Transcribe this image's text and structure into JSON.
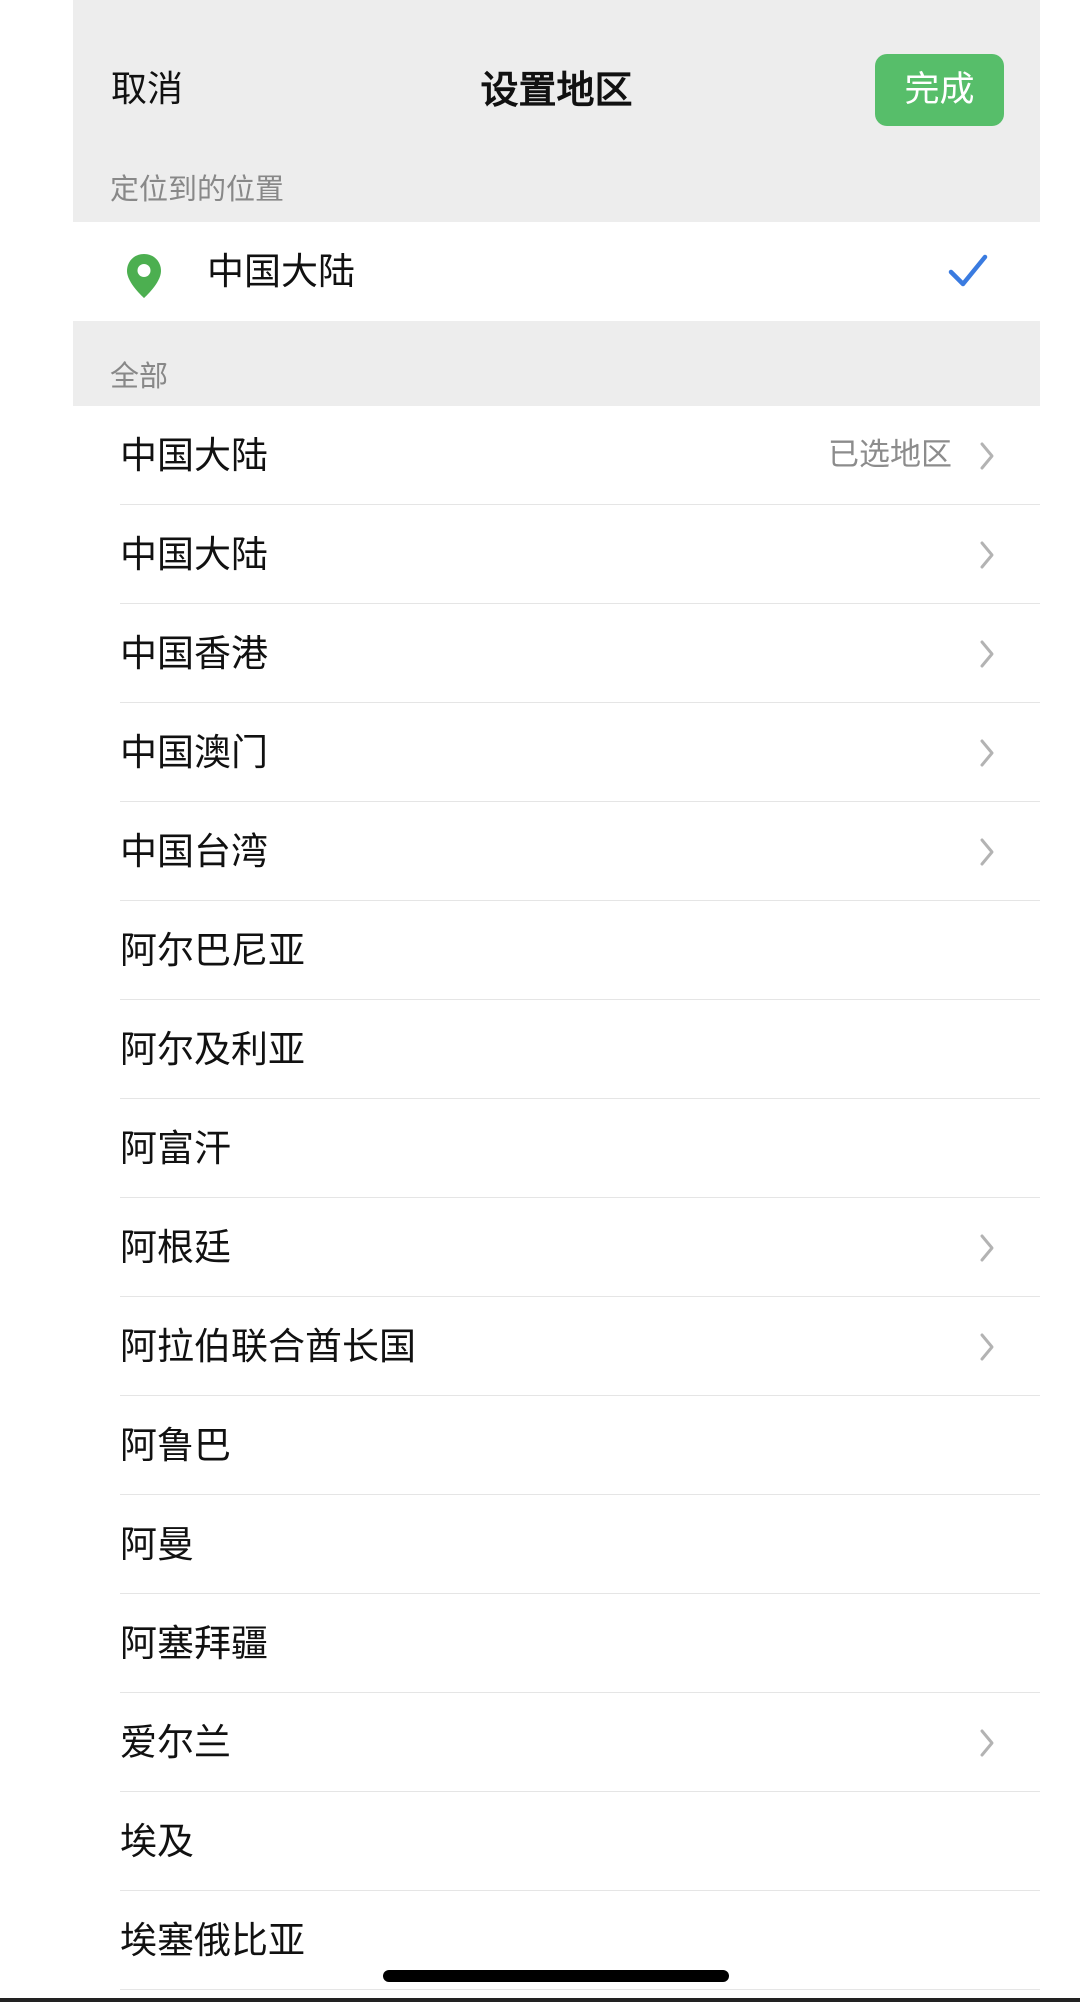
{
  "header": {
    "cancel_label": "取消",
    "title": "设置地区",
    "done_label": "完成"
  },
  "colors": {
    "accent_green": "#57be6a",
    "check_blue": "#3a7be0",
    "pin_green": "#4caf50"
  },
  "located_section": {
    "heading": "定位到的位置",
    "item_label": "中国大陆",
    "icon": "location-pin-icon",
    "selected_icon": "checkmark-icon"
  },
  "all_section": {
    "heading": "全部"
  },
  "regions": [
    {
      "label": "中国大陆",
      "tag": "已选地区",
      "has_arrow": true
    },
    {
      "label": "中国大陆",
      "tag": "",
      "has_arrow": true
    },
    {
      "label": "中国香港",
      "tag": "",
      "has_arrow": true
    },
    {
      "label": "中国澳门",
      "tag": "",
      "has_arrow": true
    },
    {
      "label": "中国台湾",
      "tag": "",
      "has_arrow": true
    },
    {
      "label": "阿尔巴尼亚",
      "tag": "",
      "has_arrow": false
    },
    {
      "label": "阿尔及利亚",
      "tag": "",
      "has_arrow": false
    },
    {
      "label": "阿富汗",
      "tag": "",
      "has_arrow": false
    },
    {
      "label": "阿根廷",
      "tag": "",
      "has_arrow": true
    },
    {
      "label": "阿拉伯联合酋长国",
      "tag": "",
      "has_arrow": true
    },
    {
      "label": "阿鲁巴",
      "tag": "",
      "has_arrow": false
    },
    {
      "label": "阿曼",
      "tag": "",
      "has_arrow": false
    },
    {
      "label": "阿塞拜疆",
      "tag": "",
      "has_arrow": false
    },
    {
      "label": "爱尔兰",
      "tag": "",
      "has_arrow": true
    },
    {
      "label": "埃及",
      "tag": "",
      "has_arrow": false
    },
    {
      "label": "埃塞俄比亚",
      "tag": "",
      "has_arrow": false
    }
  ]
}
